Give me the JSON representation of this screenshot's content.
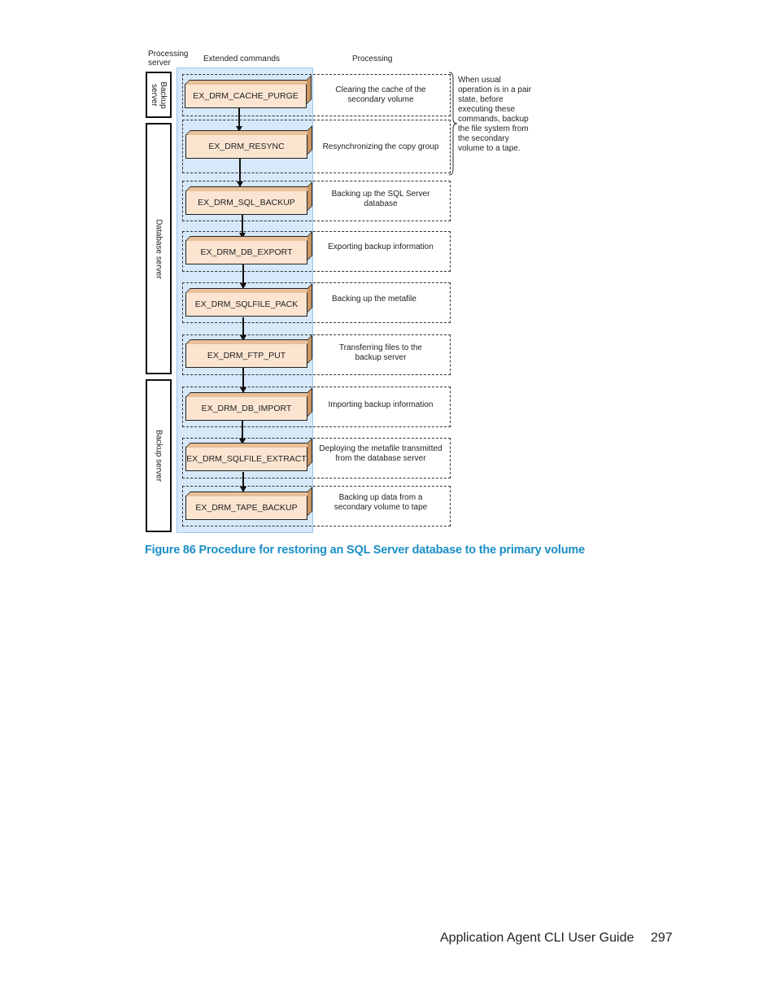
{
  "diagram": {
    "headers": {
      "processing_server": "Processing server",
      "extended_commands": "Extended commands",
      "processing": "Processing"
    },
    "servers": [
      {
        "label": "Backup server"
      },
      {
        "label": "Database  server"
      },
      {
        "label": "Backup  server"
      }
    ],
    "steps": [
      {
        "command": "EX_DRM_CACHE_PURGE",
        "processing": "Clearing the cache of the secondary volume",
        "server": "Backup server"
      },
      {
        "command": "EX_DRM_RESYNC",
        "processing": "Resynchronizing the copy group",
        "server": "Database server"
      },
      {
        "command": "EX_DRM_SQL_BACKUP",
        "processing": "Backing up the SQL Server database",
        "server": "Database server"
      },
      {
        "command": "EX_DRM_DB_EXPORT",
        "processing": "Exporting backup information",
        "server": "Database server"
      },
      {
        "command": "EX_DRM_SQLFILE_PACK",
        "processing": "Backing up the metafile",
        "server": "Database server"
      },
      {
        "command": "EX_DRM_FTP_PUT",
        "processing": "Transferring files to the backup server",
        "server": "Database server"
      },
      {
        "command": "EX_DRM_DB_IMPORT",
        "processing": "Importing backup information",
        "server": "Backup server"
      },
      {
        "command": "EX_DRM_SQLFILE_EXTRACT",
        "processing": "Deploying the metafile transmitted from the database server",
        "server": "Backup server"
      },
      {
        "command": "EX_DRM_TAPE_BACKUP",
        "processing": "Backing up data from a secondary volume to tape",
        "server": "Backup server"
      }
    ],
    "note": "When usual operation is in a pair state, before executing these commands, backup the file system from the secondary volume to a tape."
  },
  "caption": "Figure 86 Procedure for restoring an SQL Server database to the primary volume",
  "footer": {
    "title": "Application Agent CLI User Guide",
    "page_number": "297"
  }
}
